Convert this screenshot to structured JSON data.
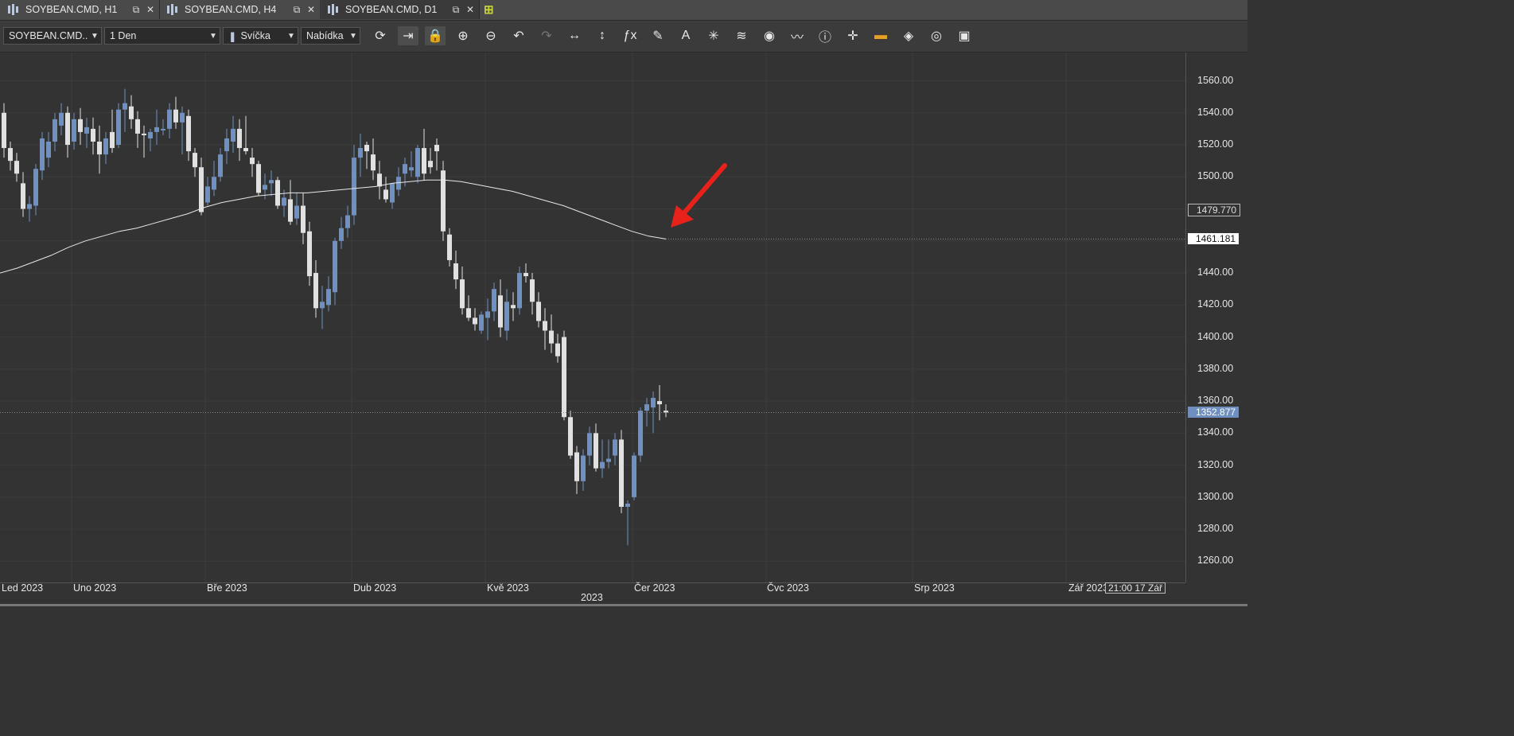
{
  "tabs": [
    {
      "label": "SOYBEAN.CMD, H1",
      "active": false
    },
    {
      "label": "SOYBEAN.CMD, H4",
      "active": false
    },
    {
      "label": "SOYBEAN.CMD, D1",
      "active": true
    }
  ],
  "toolbar": {
    "symbol": "SOYBEAN.CMD...",
    "timeframe": "1 Den",
    "chart_type": "Svíčka",
    "price_side": "Nabídka",
    "buttons": [
      "refresh-icon",
      "autoscroll-icon",
      "lock-icon",
      "zoom-in-icon",
      "zoom-out-icon",
      "undo-icon",
      "redo-icon",
      "horizontal-scale-icon",
      "vertical-scale-icon",
      "indicator-fx-icon",
      "pencil-icon",
      "text-tool-icon",
      "star-tool-icon",
      "layers-icon",
      "eye-icon",
      "chart-compare-icon",
      "info-icon",
      "crosshair-icon",
      "color-bar-icon",
      "paint-bucket-icon",
      "refresh-circle-icon",
      "save-icon"
    ]
  },
  "axis": {
    "y_ticks": [
      "1560.00",
      "1540.00",
      "1520.00",
      "1500.00",
      "1440.00",
      "1420.00",
      "1400.00",
      "1380.00",
      "1360.00",
      "1340.00",
      "1320.00",
      "1300.00",
      "1280.00",
      "1260.00"
    ],
    "y_tick_values": [
      1560,
      1540,
      1520,
      1500,
      1440,
      1420,
      1400,
      1380,
      1360,
      1340,
      1320,
      1300,
      1280,
      1260
    ],
    "ma_tag": "1479.770",
    "ma_tag_value": 1479.77,
    "last_ma_tag": "1461.181",
    "last_ma_value": 1461.181,
    "price_tag": "1352.877",
    "price_value": 1352.877,
    "x_labels": [
      "Led 2023",
      "Uno 2023",
      "Bře 2023",
      "Dub 2023",
      "Kvě 2023",
      "Čer 2023",
      "Čvc 2023",
      "Srp 2023",
      "Zář 2023"
    ],
    "year_label": "2023",
    "time_box": "21:00 17 Zář"
  },
  "colors": {
    "bull": "#7090c0",
    "bear": "#e0e0e0",
    "ma": "#e8e8e8",
    "arrow": "#e8211a",
    "grid": "#3c3c3c"
  },
  "chart_data": {
    "type": "candlestick",
    "symbol": "SOYBEAN.CMD",
    "timeframe": "D1",
    "ylim": [
      1250,
      1570
    ],
    "candles": [
      [
        1540,
        1546,
        1512,
        1518
      ],
      [
        1518,
        1522,
        1504,
        1510
      ],
      [
        1510,
        1515,
        1497,
        1502
      ],
      [
        1496,
        1503,
        1475,
        1480
      ],
      [
        1480,
        1488,
        1472,
        1483
      ],
      [
        1482,
        1508,
        1476,
        1505
      ],
      [
        1504,
        1528,
        1498,
        1524
      ],
      [
        1512,
        1528,
        1506,
        1522
      ],
      [
        1522,
        1540,
        1516,
        1536
      ],
      [
        1532,
        1546,
        1526,
        1540
      ],
      [
        1540,
        1544,
        1512,
        1520
      ],
      [
        1522,
        1540,
        1517,
        1536
      ],
      [
        1536,
        1543,
        1520,
        1528
      ],
      [
        1527,
        1537,
        1518,
        1531
      ],
      [
        1530,
        1537,
        1514,
        1522
      ],
      [
        1522,
        1532,
        1502,
        1514
      ],
      [
        1514,
        1528,
        1508,
        1524
      ],
      [
        1528,
        1542,
        1515,
        1518
      ],
      [
        1520,
        1546,
        1518,
        1542
      ],
      [
        1542,
        1555,
        1528,
        1546
      ],
      [
        1544,
        1551,
        1530,
        1536
      ],
      [
        1536,
        1541,
        1518,
        1527
      ],
      [
        1527,
        1532,
        1512,
        1526
      ],
      [
        1524,
        1530,
        1516,
        1528
      ],
      [
        1528,
        1542,
        1520,
        1531
      ],
      [
        1529,
        1536,
        1526,
        1530
      ],
      [
        1530,
        1546,
        1524,
        1542
      ],
      [
        1542,
        1550,
        1530,
        1534
      ],
      [
        1534,
        1544,
        1514,
        1540
      ],
      [
        1538,
        1542,
        1510,
        1516
      ],
      [
        1515,
        1518,
        1500,
        1506
      ],
      [
        1506,
        1512,
        1476,
        1478
      ],
      [
        1484,
        1500,
        1482,
        1494
      ],
      [
        1492,
        1510,
        1488,
        1500
      ],
      [
        1500,
        1518,
        1497,
        1514
      ],
      [
        1516,
        1530,
        1508,
        1524
      ],
      [
        1522,
        1538,
        1515,
        1530
      ],
      [
        1530,
        1536,
        1510,
        1518
      ],
      [
        1518,
        1538,
        1514,
        1516
      ],
      [
        1512,
        1518,
        1500,
        1508
      ],
      [
        1508,
        1510,
        1488,
        1490
      ],
      [
        1492,
        1502,
        1486,
        1495
      ],
      [
        1496,
        1504,
        1488,
        1498
      ],
      [
        1498,
        1500,
        1480,
        1482
      ],
      [
        1482,
        1492,
        1475,
        1487
      ],
      [
        1486,
        1498,
        1470,
        1472
      ],
      [
        1474,
        1490,
        1470,
        1482
      ],
      [
        1482,
        1490,
        1458,
        1465
      ],
      [
        1466,
        1472,
        1432,
        1438
      ],
      [
        1440,
        1448,
        1412,
        1418
      ],
      [
        1418,
        1432,
        1405,
        1422
      ],
      [
        1420,
        1438,
        1416,
        1430
      ],
      [
        1428,
        1462,
        1420,
        1460
      ],
      [
        1460,
        1475,
        1455,
        1468
      ],
      [
        1468,
        1482,
        1462,
        1476
      ],
      [
        1476,
        1520,
        1470,
        1512
      ],
      [
        1512,
        1527,
        1500,
        1518
      ],
      [
        1520,
        1522,
        1505,
        1516
      ],
      [
        1514,
        1524,
        1498,
        1504
      ],
      [
        1502,
        1510,
        1486,
        1494
      ],
      [
        1492,
        1500,
        1484,
        1486
      ],
      [
        1484,
        1496,
        1480,
        1496
      ],
      [
        1492,
        1506,
        1488,
        1500
      ],
      [
        1502,
        1512,
        1494,
        1508
      ],
      [
        1504,
        1516,
        1500,
        1506
      ],
      [
        1500,
        1520,
        1496,
        1518
      ],
      [
        1518,
        1530,
        1498,
        1502
      ],
      [
        1510,
        1518,
        1502,
        1506
      ],
      [
        1520,
        1524,
        1504,
        1516
      ],
      [
        1504,
        1510,
        1460,
        1466
      ],
      [
        1464,
        1468,
        1444,
        1448
      ],
      [
        1446,
        1454,
        1430,
        1436
      ],
      [
        1436,
        1444,
        1414,
        1418
      ],
      [
        1418,
        1426,
        1410,
        1412
      ],
      [
        1412,
        1418,
        1404,
        1408
      ],
      [
        1404,
        1416,
        1402,
        1414
      ],
      [
        1412,
        1424,
        1398,
        1416
      ],
      [
        1416,
        1434,
        1410,
        1430
      ],
      [
        1426,
        1436,
        1400,
        1406
      ],
      [
        1404,
        1430,
        1398,
        1422
      ],
      [
        1420,
        1428,
        1410,
        1418
      ],
      [
        1418,
        1444,
        1414,
        1440
      ],
      [
        1440,
        1446,
        1434,
        1438
      ],
      [
        1436,
        1440,
        1414,
        1422
      ],
      [
        1422,
        1428,
        1406,
        1410
      ],
      [
        1410,
        1418,
        1392,
        1404
      ],
      [
        1404,
        1414,
        1390,
        1396
      ],
      [
        1396,
        1402,
        1384,
        1388
      ],
      [
        1400,
        1404,
        1348,
        1350
      ],
      [
        1350,
        1354,
        1324,
        1326
      ],
      [
        1328,
        1332,
        1302,
        1310
      ],
      [
        1310,
        1330,
        1304,
        1326
      ],
      [
        1326,
        1344,
        1320,
        1340
      ],
      [
        1340,
        1346,
        1316,
        1318
      ],
      [
        1318,
        1336,
        1312,
        1322
      ],
      [
        1322,
        1336,
        1318,
        1324
      ],
      [
        1326,
        1340,
        1320,
        1336
      ],
      [
        1336,
        1342,
        1290,
        1294
      ],
      [
        1294,
        1298,
        1270,
        1296
      ],
      [
        1300,
        1328,
        1298,
        1326
      ],
      [
        1326,
        1356,
        1322,
        1354
      ],
      [
        1354,
        1362,
        1344,
        1358
      ],
      [
        1356,
        1366,
        1340,
        1362
      ],
      [
        1360,
        1370,
        1348,
        1358
      ],
      [
        1354,
        1358,
        1350,
        1352.877
      ]
    ],
    "moving_average": [
      1440,
      1443,
      1447,
      1451,
      1456,
      1460,
      1463,
      1466,
      1468,
      1471,
      1474,
      1477,
      1481,
      1484,
      1486,
      1488,
      1489,
      1490,
      1490,
      1491,
      1492,
      1493,
      1494,
      1496,
      1497,
      1498,
      1498,
      1497,
      1495,
      1493,
      1491,
      1488,
      1485,
      1482,
      1478,
      1474,
      1470,
      1466,
      1463,
      1461.181
    ],
    "annotation": "red arrow pointing to moving average end"
  }
}
